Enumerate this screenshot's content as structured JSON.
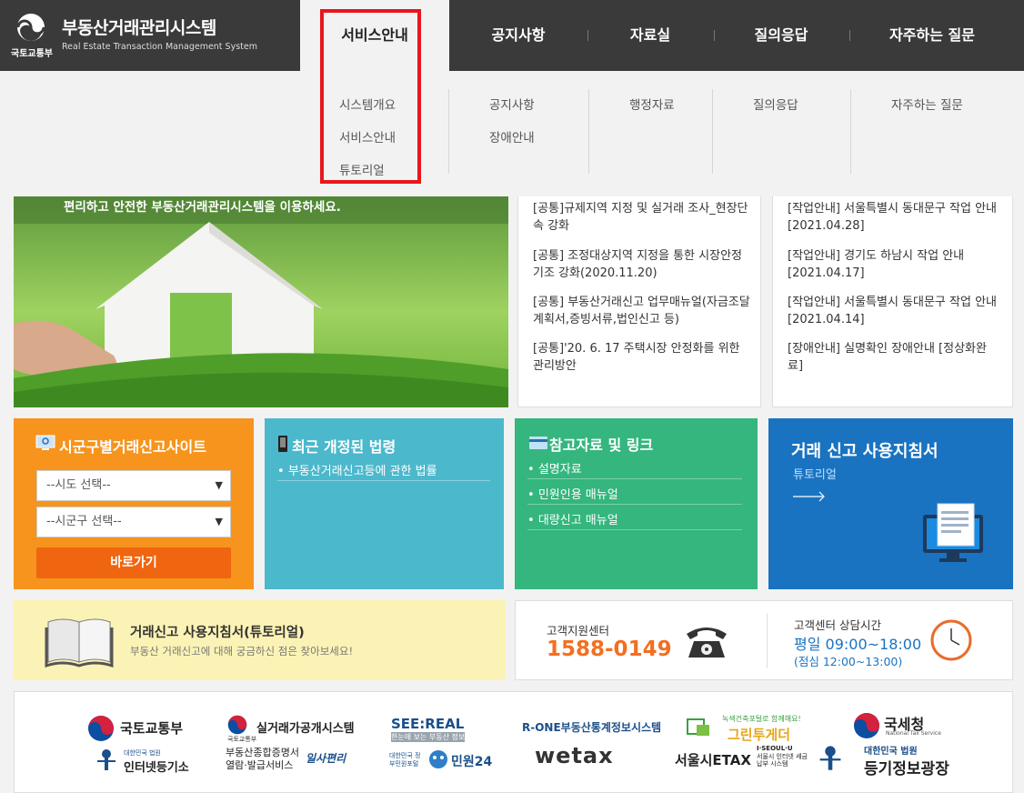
{
  "header": {
    "ministry": "국토교통부",
    "title": "부동산거래관리시스템",
    "subtitle": "Real Estate Transaction Management System",
    "nav": [
      "서비스안내",
      "공지사항",
      "자료실",
      "질의응답",
      "자주하는 질문"
    ]
  },
  "dropdown": {
    "col1": [
      "시스템개요",
      "서비스안내",
      "튜토리얼"
    ],
    "col2": [
      "공지사항",
      "장애안내"
    ],
    "col3": [
      "행정자료"
    ],
    "col4": [
      "질의응답"
    ],
    "col5": [
      "자주하는 질문"
    ]
  },
  "hero": {
    "caption": "편리하고 안전한 부동산거래관리시스템을 이용하세요."
  },
  "news_left": [
    "[공통]규제지역 지정 및 실거래 조사_현장단속 강화",
    "[공통] 조정대상지역 지정을 통한 시장안정기조 강화(2020.11.20)",
    "[공통] 부동산거래신고 업무매뉴얼(자금조달계획서,증빙서류,법인신고 등)",
    "[공통]'20. 6. 17 주택시장 안정화를 위한 관리방안"
  ],
  "news_right": [
    {
      "title": "[작업안내] 서울특별시 동대문구 작업 안내",
      "date": "[2021.04.28]"
    },
    {
      "title": "[작업안내] 경기도 하남시 작업 안내",
      "date": "[2021.04.17]"
    },
    {
      "title": "[작업안내] 서울특별시 동대문구 작업 안내",
      "date": "[2021.04.14]"
    },
    {
      "title": "[장애안내] 실명확인 장애안내 [정상화완",
      "date": "료]"
    }
  ],
  "tile_orange": {
    "title": "시군구별거래신고사이트",
    "sido": "--시도 선택--",
    "sigungu": "--시군구 선택--",
    "go": "바로가기"
  },
  "tile_teal": {
    "title": "최근 개정된 법령",
    "links": [
      "부동산거래신고등에 관한 법률"
    ]
  },
  "tile_green": {
    "title": "참고자료 및 링크",
    "links": [
      "설명자료",
      "민원인용 매뉴얼",
      "대량신고 매뉴얼"
    ]
  },
  "tile_blue": {
    "title": "거래 신고 사용지침서",
    "sub": "튜토리얼"
  },
  "tutorial": {
    "title": "거래신고 사용지침서(튜토리얼)",
    "desc": "부동산 거래신고에 대해 궁금하신 점은 찾아보세요!"
  },
  "support": {
    "label": "고객지원센터",
    "phone": "1588-0149",
    "hours_label": "고객센터 상담시간",
    "hours": "평일 09:00~18:00",
    "lunch": "(점심 12:00~13:00)"
  },
  "partners": {
    "row1": [
      "국토교통부",
      "실거래가공개시스템",
      "SEE:REAL",
      "R-ONE부동산통계정보시스템",
      "그린투게더",
      "국세청"
    ],
    "row2": [
      "인터넷등기소",
      "부동산종합증명서 열람·발급서비스",
      "민원24",
      "wetax",
      "서울시ETAX",
      "등기정보광장"
    ],
    "extra": {
      "see_real_sub": "한눈에 보는 부동산 정보",
      "green_sub": "녹색건축포털로 함께해요!",
      "court1": "대한민국 법원",
      "court2": "대한민국 법원",
      "ministry_small": "국토교통부",
      "ilsa": "일사편리",
      "gov": "대한민국 정부민원포털",
      "iseoul": "I·SEOUL·U",
      "etax_sub": "서울시 인터넷 세금납부 시스템",
      "nts_sub": "National Tax Service"
    }
  },
  "colors": {
    "header": "#3a3a3a",
    "highlight": "#e8161b",
    "orange": "#f6941d",
    "teal": "#4cb8cc",
    "green": "#34b67e",
    "blue": "#1a73c1",
    "phone": "#f36f21"
  }
}
